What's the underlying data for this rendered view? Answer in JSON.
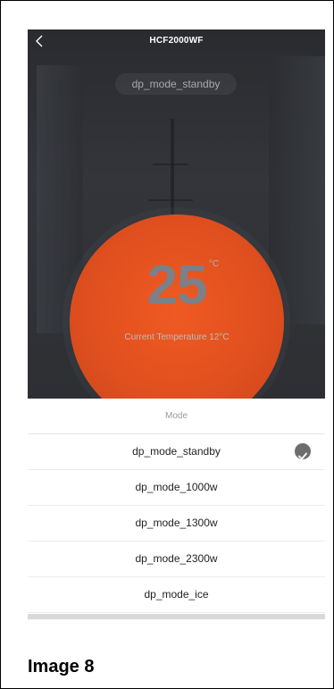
{
  "header": {
    "title": "HCF2000WF"
  },
  "hero": {
    "mode_pill": "dp_mode_standby",
    "temperature": "25",
    "unit": "°C",
    "current_temperature": "Current Temperature 12°C"
  },
  "sheet": {
    "title": "Mode",
    "options": [
      {
        "label": "dp_mode_standby",
        "selected": true
      },
      {
        "label": "dp_mode_1000w",
        "selected": false
      },
      {
        "label": "dp_mode_1300w",
        "selected": false
      },
      {
        "label": "dp_mode_2300w",
        "selected": false
      },
      {
        "label": "dp_mode_ice",
        "selected": false
      }
    ]
  },
  "caption": "Image 8",
  "colors": {
    "dial": "#e04f1f",
    "check": "#6d6d6d"
  },
  "icons": {
    "back": "chevron-left-icon",
    "check": "checkmark-icon"
  }
}
